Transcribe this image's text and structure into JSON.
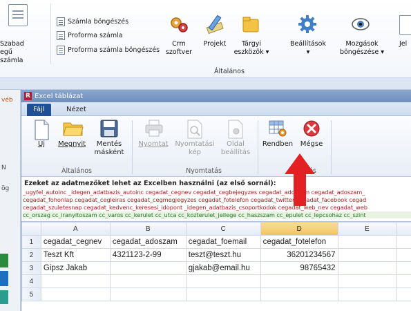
{
  "background_app": {
    "left_button_label_1": "Szabad",
    "left_button_label_2": "egű számla",
    "side_items": [
      "Számla böngészés",
      "Proforma számla",
      "Proforma számla böngészés"
    ],
    "buttons": [
      {
        "label": "Crm\nszoftver",
        "icon": "gears-icon"
      },
      {
        "label": "Projekt",
        "icon": "pencil-ruler-icon"
      },
      {
        "label": "Tárgyi\neszközök ▾",
        "icon": "folder-icon"
      },
      {
        "label": "Beállítások\n▾",
        "icon": "gear-icon"
      },
      {
        "label": "Mozgások\nböngészése ▾",
        "icon": "eye-icon"
      },
      {
        "label": "Jel",
        "icon": "doc-icon"
      }
    ],
    "group_label": "Általános",
    "left_fragments": [
      "véb",
      "ög",
      "N"
    ]
  },
  "excel_window": {
    "title": "Excel táblázat",
    "logo_letter": "R",
    "tabs": [
      "Fájl",
      "Nézet"
    ],
    "ribbon": {
      "buttons": [
        {
          "label": "Új",
          "icon": "new-document-icon",
          "enabled": true
        },
        {
          "label": "Megnyit",
          "icon": "open-folder-icon",
          "enabled": true
        },
        {
          "label": "Mentés\nmásként",
          "icon": "save-icon",
          "enabled": true
        },
        {
          "label": "Nyomtat",
          "icon": "printer-icon",
          "enabled": false
        },
        {
          "label": "Nyomtatási\nkép",
          "icon": "print-preview-icon",
          "enabled": false
        },
        {
          "label": "Oldal\nbeállítás",
          "icon": "page-setup-icon",
          "enabled": false
        },
        {
          "label": "Rendben",
          "icon": "ok-table-icon",
          "enabled": true
        },
        {
          "label": "Mégse",
          "icon": "cancel-icon",
          "enabled": true
        }
      ],
      "groups": [
        "Általános",
        "Nyomtatás",
        "Lépés"
      ]
    },
    "instructions": {
      "heading": "Ezeket az adatmezőket lehet az Excelben használni (az első sornál):",
      "lines": [
        "_ugyfel_autoinc _idegen_adatbazis_autoinc cegadat_cegnev cegadat_cegbejegyzes cegadat_adoszam cegadat_adoszam_",
        "cegadat_fohonlap cegadat_cegleiras cegadat_cegmegjegyzes cegadat_fotelefon cegadat_twitter cegadat_facebook cegad",
        "cegadat_szuletesnap cegadat_kedvenc_keresesi_idopont _idegen_adatbazis_csoportkodok cegadat_web_nev cegadat_web",
        " cc_orszag cc_iranyitoszam cc_varos cc_kerulet cc_utca cc_kozterulet_jellege cc_haszszam cc_epulet cc_lepcsohaz cc_szint"
      ]
    },
    "sheet": {
      "columns": [
        "A",
        "B",
        "C",
        "D",
        "E"
      ],
      "selected_column": "D",
      "rows": [
        {
          "num": "1",
          "cells": [
            "cegadat_cegnev",
            "cegadat_adoszam",
            "cegadat_foemail",
            "cegadat_fotelefon",
            ""
          ]
        },
        {
          "num": "2",
          "cells": [
            "Teszt Kft",
            "4321123-2-99",
            "teszt@teszt.hu",
            "36201234567",
            ""
          ]
        },
        {
          "num": "3",
          "cells": [
            "Gipsz Jakab",
            "",
            "gjakab@email.hu",
            "98765432",
            ""
          ]
        },
        {
          "num": "4",
          "cells": [
            "",
            "",
            "",
            "",
            ""
          ]
        },
        {
          "num": "5",
          "cells": [
            "",
            "",
            "",
            "",
            ""
          ]
        }
      ]
    }
  },
  "colors": {
    "file_tab": "#1f4f94",
    "arrow": "#e32024",
    "selected_header": "#f2c35f"
  }
}
